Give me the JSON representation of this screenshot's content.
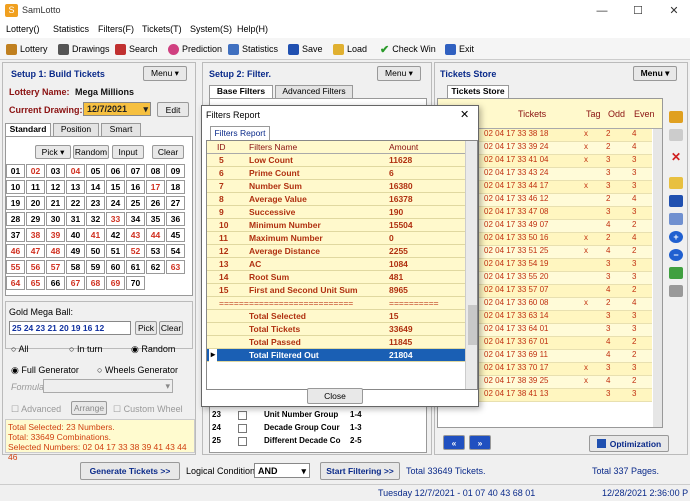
{
  "app": {
    "title": "SamLotto"
  },
  "menu": [
    "Lottery()",
    "Statistics",
    "Filters(F)",
    "Tickets(T)",
    "System(S)",
    "Help(H)"
  ],
  "toolbar": [
    "Lottery",
    "Drawings",
    "Search",
    "Prediction",
    "Statistics",
    "Save",
    "Load",
    "Check Win",
    "Exit"
  ],
  "left": {
    "title": "Setup 1: Build  Tickets",
    "menu": "Menu ▾",
    "lottery_label": "Lottery  Name:",
    "lottery_name": "Mega Millions",
    "drawing_label": "Current Drawing:",
    "drawing_value": "12/7/2021",
    "edit": "Edit",
    "tabs": [
      "Standard",
      "Position",
      "Smart"
    ],
    "pick": "Pick ▾",
    "random": "Random",
    "input": "Input",
    "clear": "Clear",
    "numbers": [
      "01",
      "02",
      "03",
      "04",
      "05",
      "06",
      "07",
      "08",
      "09",
      "10",
      "11",
      "12",
      "13",
      "14",
      "15",
      "16",
      "17",
      "18",
      "19",
      "20",
      "21",
      "22",
      "23",
      "24",
      "25",
      "26",
      "27",
      "28",
      "29",
      "30",
      "31",
      "32",
      "33",
      "34",
      "35",
      "36",
      "37",
      "38",
      "39",
      "40",
      "41",
      "42",
      "43",
      "44",
      "45",
      "46",
      "47",
      "48",
      "49",
      "50",
      "51",
      "52",
      "53",
      "54",
      "55",
      "56",
      "57",
      "58",
      "59",
      "60",
      "61",
      "62",
      "63",
      "64",
      "65",
      "66",
      "67",
      "68",
      "69",
      "70"
    ],
    "mega_label": "Gold Mega Ball:",
    "mega_value": "25 24 23 21 20 19 16 12",
    "mega_pick": "Pick",
    "mega_clear": "Clear",
    "radio_all": "All",
    "radio_inturn": "In turn",
    "radio_random": "Random",
    "full_gen": "Full Generator",
    "wheel_gen": "Wheels Generator",
    "formula": "Formula:",
    "advanced": "Advanced",
    "arrange": "Arrange",
    "custom_wheel": "Custom Wheel",
    "summary": [
      "Total Selected: 23 Numbers.",
      "Total: 33649 Combinations.",
      "Selected Numbers: 02 04 17 33 38 39 41 43 44 46"
    ]
  },
  "middle": {
    "title": "Setup 2: Filter.",
    "menu": "Menu ▾",
    "tabs": [
      "Base Filters",
      "Advanced Filters"
    ],
    "rows": [
      {
        "id": "23",
        "name": "Unit Number Group",
        "val": "1-4"
      },
      {
        "id": "24",
        "name": "Decade Group Cour",
        "val": "1-3"
      },
      {
        "id": "25",
        "name": "Different Decade Co",
        "val": "2-5"
      }
    ]
  },
  "right": {
    "title": "Tickets Store",
    "menu": "Menu ▾",
    "tab": "Tickets Store",
    "headers": [
      "Tickets",
      "Tag",
      "Odd",
      "Even"
    ],
    "tickets": [
      [
        "02 04 17 33 38 18",
        "x",
        "2",
        "4"
      ],
      [
        "02 04 17 33 39 24",
        "x",
        "2",
        "4"
      ],
      [
        "02 04 17 33 41 04",
        "x",
        "3",
        "3"
      ],
      [
        "02 04 17 33 43 24",
        "",
        "3",
        "3"
      ],
      [
        "02 04 17 33 44 17",
        "x",
        "3",
        "3"
      ],
      [
        "02 04 17 33 46 12",
        "",
        "2",
        "4"
      ],
      [
        "02 04 17 33 47 08",
        "",
        "3",
        "3"
      ],
      [
        "02 04 17 33 49 07",
        "",
        "4",
        "2"
      ],
      [
        "02 04 17 33 50 16",
        "x",
        "2",
        "4"
      ],
      [
        "02 04 17 33 51 25",
        "x",
        "4",
        "2"
      ],
      [
        "02 04 17 33 54 19",
        "",
        "3",
        "3"
      ],
      [
        "02 04 17 33 55 20",
        "",
        "3",
        "3"
      ],
      [
        "02 04 17 33 57 07",
        "",
        "4",
        "2"
      ],
      [
        "02 04 17 33 60 08",
        "x",
        "2",
        "4"
      ],
      [
        "02 04 17 33 63 14",
        "",
        "3",
        "3"
      ],
      [
        "02 04 17 33 64 01",
        "",
        "3",
        "3"
      ],
      [
        "02 04 17 33 67 01",
        "",
        "4",
        "2"
      ],
      [
        "02 04 17 33 69 11",
        "",
        "4",
        "2"
      ],
      [
        "02 04 17 33 70 17",
        "x",
        "3",
        "3"
      ],
      [
        "02 04 17 38 39 25",
        "x",
        "4",
        "2"
      ],
      [
        "02 04 17 38 41 13",
        "",
        "3",
        "3"
      ]
    ],
    "optimization": "Optimization",
    "pages": "Total 337 Pages."
  },
  "modal": {
    "title": "Filters Report",
    "tab": "Filters Report",
    "headers": [
      "ID",
      "Filters Name",
      "Amount"
    ],
    "rows": [
      [
        "5",
        "Low Count",
        "11628"
      ],
      [
        "6",
        "Prime Count",
        "6"
      ],
      [
        "7",
        "Number Sum",
        "16380"
      ],
      [
        "8",
        "Average Value",
        "16378"
      ],
      [
        "9",
        "Successive",
        "190"
      ],
      [
        "10",
        "Minimum Number",
        "15504"
      ],
      [
        "11",
        "Maximum Number",
        "0"
      ],
      [
        "12",
        "Average Distance",
        "2255"
      ],
      [
        "13",
        "AC",
        "1084"
      ],
      [
        "14",
        "Root Sum",
        "481"
      ],
      [
        "15",
        "First and Second Unit Sum",
        "8965"
      ],
      [
        "======",
        "=====================",
        "=========="
      ],
      [
        "",
        "Total Selected",
        "15"
      ],
      [
        "",
        "Total Tickets",
        "33649"
      ],
      [
        "",
        "Total Passed",
        "11845"
      ],
      [
        "",
        "Total Filtered Out",
        "21804"
      ]
    ],
    "close": "Close"
  },
  "bottom": {
    "generate": "Generate Tickets >>",
    "logic_label": "Logical Condition:",
    "logic_value": "AND",
    "start": "Start Filtering >>",
    "count": "Total 33649 Tickets."
  },
  "status": {
    "left": "Tuesday 12/7/2021 - 01 07 40 43 68 01",
    "right": "12/28/2021 2:36:00 P"
  }
}
